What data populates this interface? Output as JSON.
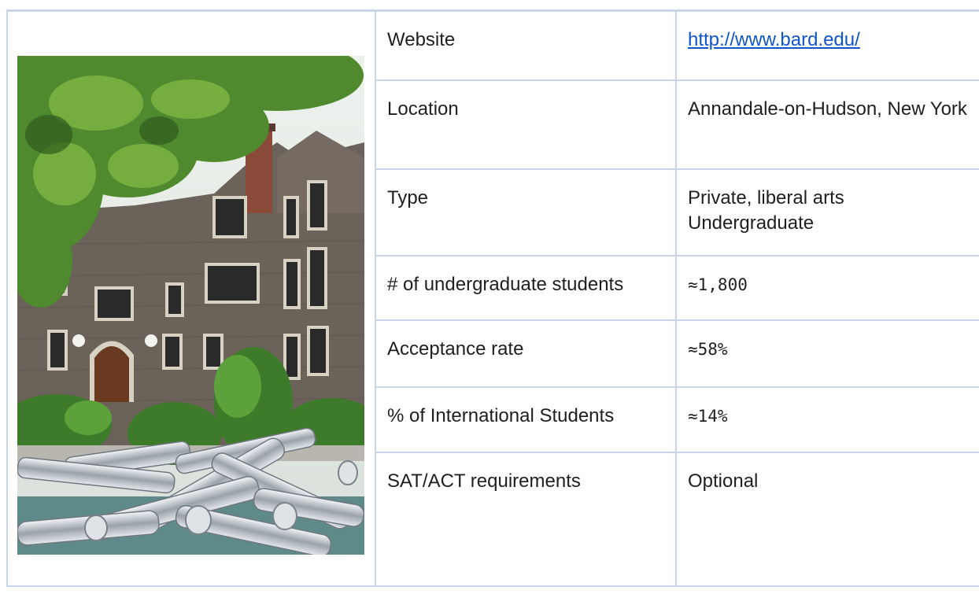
{
  "rows": [
    {
      "label": "Website",
      "value": "http://www.bard.edu/"
    },
    {
      "label": "Location",
      "value": "Annandale-on-Hudson, New York"
    },
    {
      "label": "Type",
      "value": "Private, liberal arts Undergraduate"
    },
    {
      "label": "# of undergraduate students",
      "value": "≈1,800"
    },
    {
      "label": "Acceptance rate",
      "value": "≈58%"
    },
    {
      "label": "% of International Students",
      "value": "≈14%"
    },
    {
      "label": "SAT/ACT requirements",
      "value": "Optional"
    }
  ],
  "colors": {
    "border": "#c9d6ea",
    "link": "#1155cc"
  }
}
